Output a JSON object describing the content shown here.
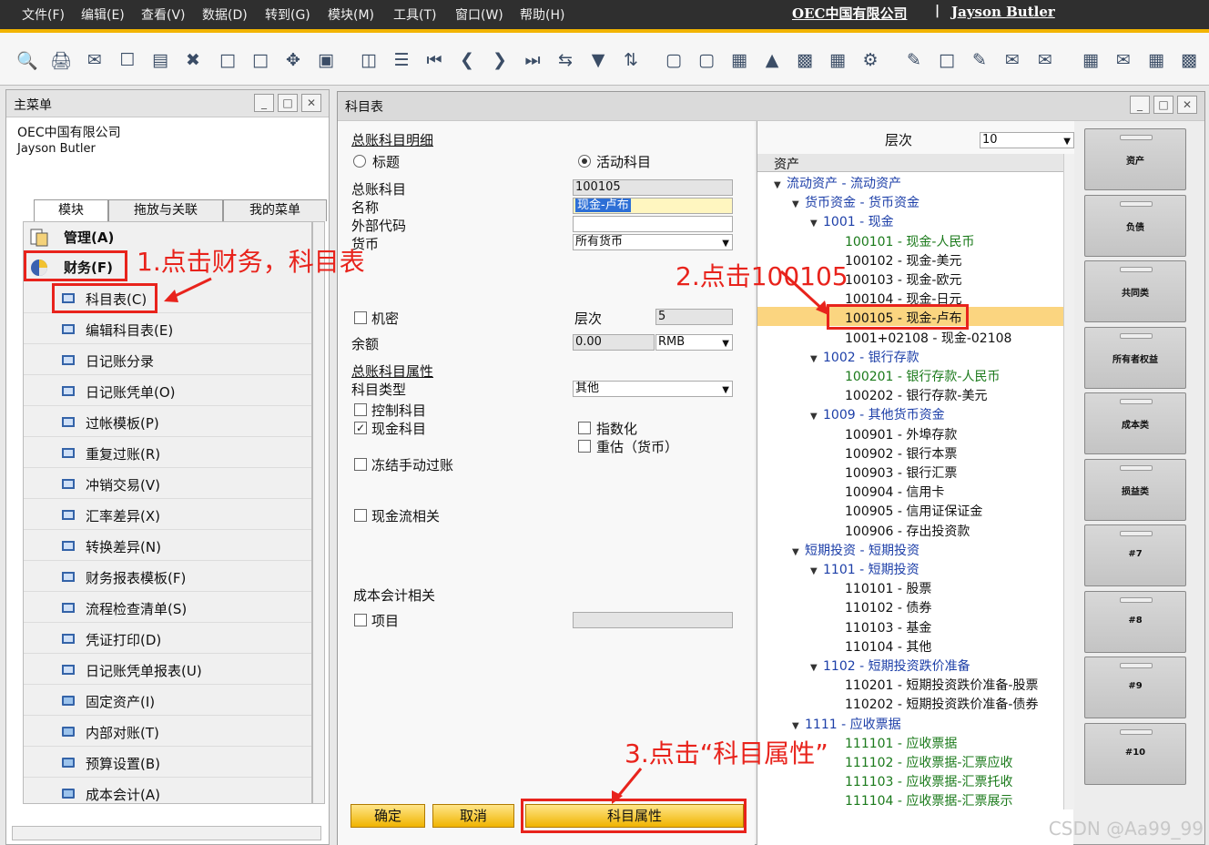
{
  "menu": {
    "items": [
      "文件(F)",
      "编辑(E)",
      "查看(V)",
      "数据(D)",
      "转到(G)",
      "模块(M)",
      "工具(T)",
      "窗口(W)",
      "帮助(H)"
    ],
    "company": "OEC中国有限公司",
    "separator": "|",
    "user": "Jayson Butler"
  },
  "toolbar": {
    "icons": [
      "print-preview-icon",
      "print-icon",
      "email-icon",
      "sms-icon",
      "fax-icon",
      "excel-icon",
      "word-icon",
      "pdf-icon",
      "navigate-icon",
      "doc-icon",
      "find-icon",
      "list-icon",
      "first-icon",
      "prev-icon",
      "next-icon",
      "last-icon",
      "refresh-icon",
      "filter-icon",
      "sort-icon",
      "base-doc-icon",
      "target-doc-icon",
      "doc-flow-icon",
      "gross-profit-icon",
      "volume-icon",
      "journal-icon",
      "payment-icon",
      "edit-icon",
      "new-doc-icon",
      "export-icon",
      "message-icon",
      "chat-icon",
      "calendar-icon",
      "mail-icon",
      "table-icon",
      "org-icon"
    ]
  },
  "left_panel": {
    "title": "主菜单",
    "company": "OEC中国有限公司",
    "user": "Jayson Butler",
    "tabs": [
      "模块",
      "拖放与关联",
      "我的菜单"
    ],
    "modules": [
      {
        "label": "管理(A)"
      },
      {
        "label": "财务(F)"
      }
    ],
    "items": [
      {
        "label": "科目表(C)",
        "type": "form"
      },
      {
        "label": "编辑科目表(E)",
        "type": "form"
      },
      {
        "label": "日记账分录",
        "type": "form"
      },
      {
        "label": "日记账凭单(O)",
        "type": "form"
      },
      {
        "label": "过帐模板(P)",
        "type": "form"
      },
      {
        "label": "重复过账(R)",
        "type": "form"
      },
      {
        "label": "冲销交易(V)",
        "type": "form"
      },
      {
        "label": "汇率差异(X)",
        "type": "form"
      },
      {
        "label": "转换差异(N)",
        "type": "form"
      },
      {
        "label": "财务报表模板(F)",
        "type": "form"
      },
      {
        "label": "流程检查清单(S)",
        "type": "form"
      },
      {
        "label": "凭证打印(D)",
        "type": "form"
      },
      {
        "label": "日记账凭单报表(U)",
        "type": "form"
      },
      {
        "label": "固定资产(I)",
        "type": "folder"
      },
      {
        "label": "内部对账(T)",
        "type": "folder"
      },
      {
        "label": "预算设置(B)",
        "type": "folder"
      },
      {
        "label": "成本会计(A)",
        "type": "folder"
      }
    ]
  },
  "account_window": {
    "title": "科目表",
    "section_detail": "总账科目明细",
    "radio_title": "标题",
    "radio_active": "活动科目",
    "gl_account_label": "总账科目",
    "gl_account_value": "100105",
    "name_label": "名称",
    "name_value": "现金-卢布",
    "ext_code_label": "外部代码",
    "ext_code_value": "",
    "currency_label": "货币",
    "currency_value": "所有货币",
    "confidential_label": "机密",
    "level_label": "层次",
    "level_value": "5",
    "balance_label": "余额",
    "balance_value": "0.00",
    "balance_currency": "RMB",
    "section_props": "总账科目属性",
    "acct_type_label": "科目类型",
    "acct_type_value": "其他",
    "control_label": "控制科目",
    "cash_label": "现金科目",
    "indexed_label": "指数化",
    "revalue_label": "重估（货币）",
    "freeze_label": "冻结手动过账",
    "cashflow_label": "现金流相关",
    "costing_label": "成本会计相关",
    "project_label": "项目",
    "project_value": "",
    "tree_level_label": "层次",
    "tree_level_value": "10",
    "tree_header": "资产",
    "ok_button": "确定",
    "cancel_button": "取消",
    "props_button": "科目属性"
  },
  "tree": [
    {
      "text": "流动资产 - 流动资产",
      "level": 0,
      "kind": "title",
      "open": true
    },
    {
      "text": "货币资金 - 货币资金",
      "level": 1,
      "kind": "title",
      "open": true
    },
    {
      "text": "1001 - 现金",
      "level": 2,
      "kind": "title",
      "open": true
    },
    {
      "text": "100101 - 现金-人民币",
      "level": 3,
      "kind": "green"
    },
    {
      "text": "100102 - 现金-美元",
      "level": 3,
      "kind": "plain"
    },
    {
      "text": "100103 - 现金-欧元",
      "level": 3,
      "kind": "plain"
    },
    {
      "text": "100104 - 现金-日元",
      "level": 3,
      "kind": "plain"
    },
    {
      "text": "100105 - 现金-卢布",
      "level": 3,
      "kind": "plain",
      "selected": true
    },
    {
      "text": "1001+02108 - 现金-02108",
      "level": 3,
      "kind": "plain"
    },
    {
      "text": "1002 - 银行存款",
      "level": 2,
      "kind": "title",
      "open": true
    },
    {
      "text": "100201 - 银行存款-人民币",
      "level": 3,
      "kind": "green"
    },
    {
      "text": "100202 - 银行存款-美元",
      "level": 3,
      "kind": "plain"
    },
    {
      "text": "1009 - 其他货币资金",
      "level": 2,
      "kind": "title",
      "open": true
    },
    {
      "text": "100901 - 外埠存款",
      "level": 3,
      "kind": "plain"
    },
    {
      "text": "100902 - 银行本票",
      "level": 3,
      "kind": "plain"
    },
    {
      "text": "100903 - 银行汇票",
      "level": 3,
      "kind": "plain"
    },
    {
      "text": "100904 - 信用卡",
      "level": 3,
      "kind": "plain"
    },
    {
      "text": "100905 - 信用证保证金",
      "level": 3,
      "kind": "plain"
    },
    {
      "text": "100906 - 存出投资款",
      "level": 3,
      "kind": "plain"
    },
    {
      "text": "短期投资 - 短期投资",
      "level": 1,
      "kind": "title",
      "open": true
    },
    {
      "text": "1101 - 短期投资",
      "level": 2,
      "kind": "title",
      "open": true
    },
    {
      "text": "110101 - 股票",
      "level": 3,
      "kind": "plain"
    },
    {
      "text": "110102 - 债券",
      "level": 3,
      "kind": "plain"
    },
    {
      "text": "110103 - 基金",
      "level": 3,
      "kind": "plain"
    },
    {
      "text": "110104 - 其他",
      "level": 3,
      "kind": "plain"
    },
    {
      "text": "1102 - 短期投资跌价准备",
      "level": 2,
      "kind": "title",
      "open": true
    },
    {
      "text": "110201 - 短期投资跌价准备-股票",
      "level": 3,
      "kind": "plain"
    },
    {
      "text": "110202 - 短期投资跌价准备-债券",
      "level": 3,
      "kind": "plain"
    },
    {
      "text": "1111 - 应收票据",
      "level": 1,
      "kind": "title",
      "open": true
    },
    {
      "text": "111101 - 应收票据",
      "level": 3,
      "kind": "green"
    },
    {
      "text": "111102 - 应收票据-汇票应收",
      "level": 3,
      "kind": "green"
    },
    {
      "text": "111103 - 应收票据-汇票托收",
      "level": 3,
      "kind": "green"
    },
    {
      "text": "111104 - 应收票据-汇票展示",
      "level": 3,
      "kind": "green"
    }
  ],
  "drawers": [
    "资产",
    "负债",
    "共同类",
    "所有者权益",
    "成本类",
    "损益类",
    "#7",
    "#8",
    "#9",
    "#10"
  ],
  "annotations": {
    "step1": "1.点击财务，科目表",
    "step2": "2.点击100105",
    "step3": "3.点击“科目属性”"
  },
  "watermark": "CSDN @Aa99_99",
  "colors": {
    "menubar": "#2f2f2f",
    "accent": "#f2b400",
    "annotation": "#e8231c",
    "tree_title": "#1d3fa8",
    "tree_green": "#1b7a1b",
    "selected_row": "#fbd580"
  }
}
